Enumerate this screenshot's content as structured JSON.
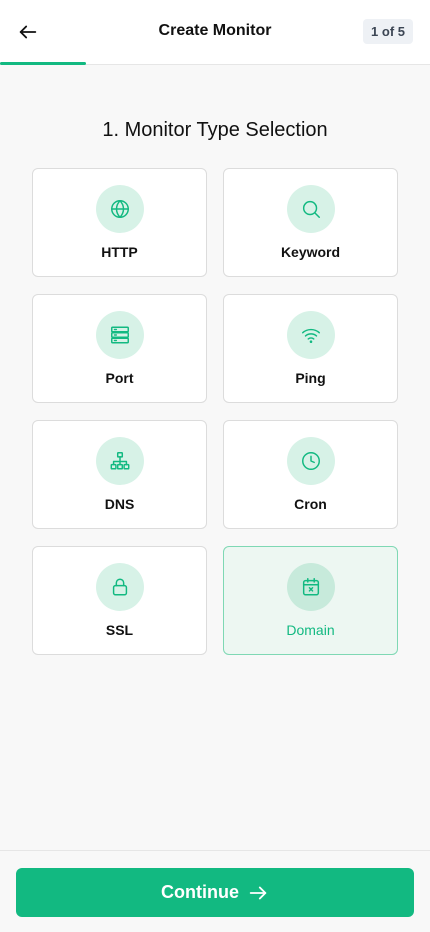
{
  "header": {
    "title": "Create Monitor",
    "step_badge": "1 of 5",
    "progress": 0.2
  },
  "section": {
    "title": "1. Monitor Type Selection"
  },
  "monitor_types": [
    {
      "label": "HTTP",
      "icon": "globe-icon",
      "selected": false
    },
    {
      "label": "Keyword",
      "icon": "search-icon",
      "selected": false
    },
    {
      "label": "Port",
      "icon": "server-icon",
      "selected": false
    },
    {
      "label": "Ping",
      "icon": "wifi-icon",
      "selected": false
    },
    {
      "label": "DNS",
      "icon": "network-icon",
      "selected": false
    },
    {
      "label": "Cron",
      "icon": "clock-icon",
      "selected": false
    },
    {
      "label": "SSL",
      "icon": "lock-icon",
      "selected": false
    },
    {
      "label": "Domain",
      "icon": "calendar-x-icon",
      "selected": true
    }
  ],
  "footer": {
    "continue_label": "Continue"
  },
  "colors": {
    "accent": "#12b981",
    "icon_bg": "#d7f2e7",
    "selected_bg": "#edf7f2"
  }
}
